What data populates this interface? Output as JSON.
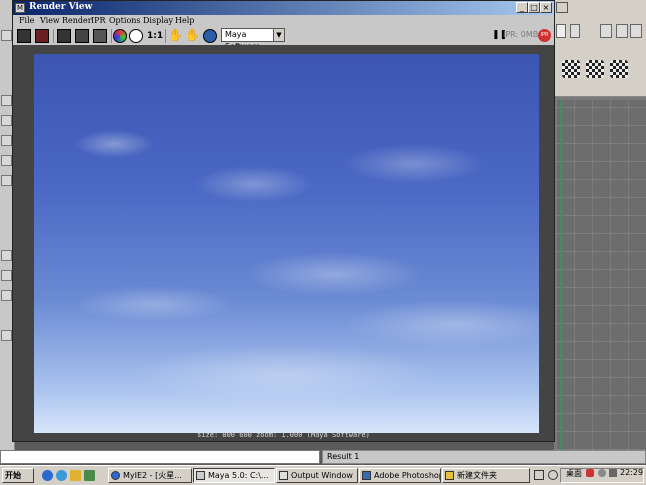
{
  "render_window": {
    "title": "Render View",
    "menu": [
      "File",
      "View",
      "Render",
      "IPR",
      "Options",
      "Display",
      "Help"
    ],
    "toolbar": {
      "ratio_label": "1:1",
      "renderer": "Maya Software",
      "ipr_status": "IPR: 0MB",
      "ipr_stop": "IPR"
    },
    "image_info": "size: 800 600 zoom: 1.000 (Maya Software)"
  },
  "result_line": "Result 1",
  "taskbar": {
    "start": "开始",
    "tasks": [
      {
        "label": "MyIE2 - [火星..."
      },
      {
        "label": "Maya 5.0: C:\\..."
      },
      {
        "label": "Output Window"
      },
      {
        "label": "Adobe Photoshop"
      },
      {
        "label": "新建文件夹"
      }
    ],
    "desktop": "桌面",
    "clock": "22:29"
  },
  "colors": {
    "title_gradient_start": "#0a246a",
    "title_gradient_end": "#a6caf0",
    "sky_top": "#3c55b2",
    "sky_bottom": "#d8e6fb"
  }
}
